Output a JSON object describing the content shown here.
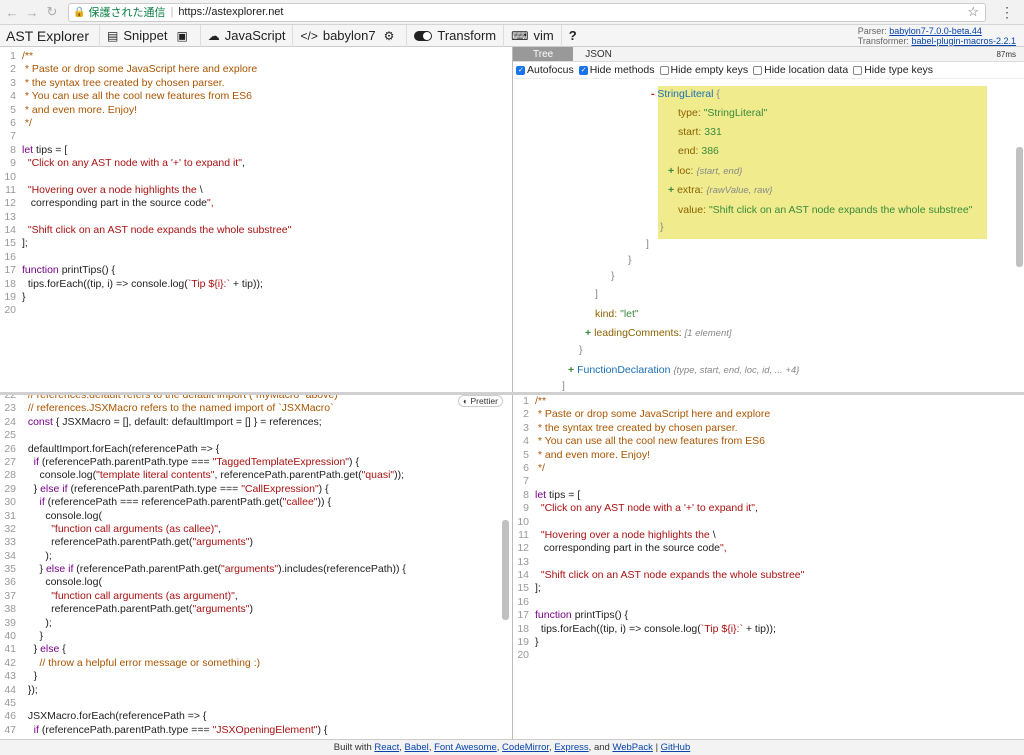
{
  "browser": {
    "back": "←",
    "forward": "→",
    "reload": "↻",
    "secure_label": "保護された通信",
    "url": "https://astexplorer.net"
  },
  "toolbar": {
    "title": "AST Explorer",
    "snippet": "Snippet",
    "language": "JavaScript",
    "parser": "babylon7",
    "transform": "Transform",
    "keymap": "vim",
    "help": "?",
    "parser_label": "Parser:",
    "parser_value": "babylon7-7.0.0-beta.44",
    "transformer_label": "Transformer:",
    "transformer_value": "babel-plugin-macros-2.2.1"
  },
  "result_tabs": {
    "tree": "Tree",
    "json": "JSON",
    "timing": "87ms"
  },
  "options": {
    "autofocus": "Autofocus",
    "hide_methods": "Hide methods",
    "hide_empty": "Hide empty keys",
    "hide_location": "Hide location data",
    "hide_type": "Hide type keys"
  },
  "tree": {
    "node_type": "StringLiteral",
    "type_key": "type:",
    "type_val": "\"StringLiteral\"",
    "start_key": "start:",
    "start_val": "331",
    "end_key": "end:",
    "end_val": "386",
    "loc_key": "loc:",
    "loc_meta": "{start, end}",
    "extra_key": "extra:",
    "extra_meta": "{rawValue, raw}",
    "value_key": "value:",
    "value_val": "\"Shift click on an AST node expands the whole substree\"",
    "kind_key": "kind:",
    "kind_val": "\"let\"",
    "leading_key": "leadingComments:",
    "leading_meta": "[1 element]",
    "func_type": "FunctionDeclaration",
    "func_meta": "{type, start, end, loc, id, ... +4}"
  },
  "prettier": "Prettier",
  "source_code": [
    "/**",
    " * Paste or drop some JavaScript here and explore",
    " * the syntax tree created by chosen parser.",
    " * You can use all the cool new features from ES6",
    " * and even more. Enjoy!",
    " */",
    "",
    "let tips = [",
    "  \"Click on any AST node with a '+' to expand it\",",
    "",
    "  \"Hovering over a node highlights the \\",
    "   corresponding part in the source code\",",
    "",
    "  \"Shift click on an AST node expands the whole substree\"",
    "];",
    "",
    "function printTips() {",
    "  tips.forEach((tip, i) => console.log(`Tip ${i}:` + tip));",
    "}",
    ""
  ],
  "transform_code_start": 22,
  "transform_code": [
    "  // references.default refers to the default import (`myMacro` above)",
    "  // references.JSXMacro refers to the named import of `JSXMacro`",
    "  const { JSXMacro = [], default: defaultImport = [] } = references;",
    "",
    "  defaultImport.forEach(referencePath => {",
    "    if (referencePath.parentPath.type === \"TaggedTemplateExpression\") {",
    "      console.log(\"template literal contents\", referencePath.parentPath.get(\"quasi\"));",
    "    } else if (referencePath.parentPath.type === \"CallExpression\") {",
    "      if (referencePath === referencePath.parentPath.get(\"callee\")) {",
    "        console.log(",
    "          \"function call arguments (as callee)\",",
    "          referencePath.parentPath.get(\"arguments\")",
    "        );",
    "      } else if (referencePath.parentPath.get(\"arguments\").includes(referencePath)) {",
    "        console.log(",
    "          \"function call arguments (as argument)\",",
    "          referencePath.parentPath.get(\"arguments\")",
    "        );",
    "      }",
    "    } else {",
    "      // throw a helpful error message or something :)",
    "    }",
    "  });",
    "",
    "  JSXMacro.forEach(referencePath => {",
    "    if (referencePath.parentPath.type === \"JSXOpeningElement\") {"
  ],
  "footer": {
    "built_with": "Built with",
    "links": [
      "React",
      "Babel",
      "Font Awesome",
      "CodeMirror",
      "Express",
      "WebPack",
      "GitHub"
    ],
    "comma": ",",
    "and": "and",
    "pipe": "|"
  }
}
